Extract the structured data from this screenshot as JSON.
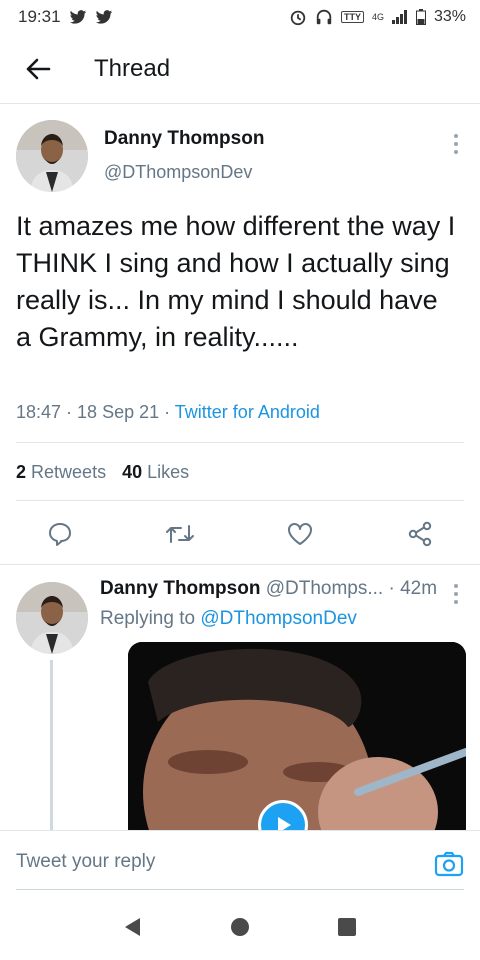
{
  "status_bar": {
    "time": "19:31",
    "tty": "TTY",
    "network": "4G",
    "battery": "33%"
  },
  "header": {
    "title": "Thread"
  },
  "tweet": {
    "author_name": "Danny Thompson",
    "author_handle": "@DThompsonDev",
    "text": "It amazes me how different the way I THINK I sing and how I actually sing really is... In my mind I should have a Grammy, in reality......",
    "time": "18:47",
    "date": "18 Sep 21",
    "source": "Twitter for Android",
    "retweet_count": "2",
    "retweet_label": "Retweets",
    "like_count": "40",
    "like_label": "Likes"
  },
  "reply": {
    "author_name": "Danny Thompson",
    "author_handle": "@DThomps...",
    "time": "42m",
    "replying_prefix": "Replying to",
    "replying_to": "@DThompsonDev"
  },
  "composer": {
    "placeholder": "Tweet your reply"
  },
  "icons": {
    "back": "arrow-left-icon",
    "reply": "comment-icon",
    "retweet": "retweet-icon",
    "like": "heart-icon",
    "share": "share-icon",
    "camera": "camera-icon",
    "nav_back": "triangle-back-icon",
    "nav_home": "circle-home-icon",
    "nav_recents": "square-recents-icon"
  },
  "colors": {
    "accent": "#1da1f2",
    "link": "#1b95e0",
    "muted": "#657786",
    "divider": "#e1e8ed"
  }
}
